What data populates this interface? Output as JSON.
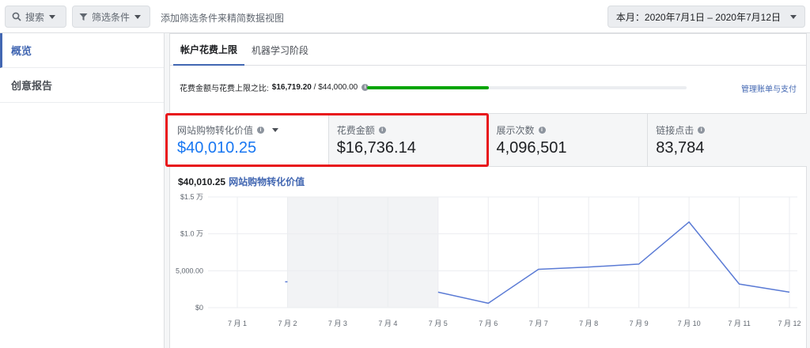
{
  "topbar": {
    "search_label": "搜索",
    "filter_label": "筛选条件",
    "hint": "添加筛选条件来精简数据视图",
    "date_range": "本月：2020年7月1日 – 2020年7月12日"
  },
  "sidebar": {
    "items": [
      {
        "label": "概览",
        "active": true
      },
      {
        "label": "创意报告",
        "active": false
      }
    ]
  },
  "tabs": [
    {
      "label": "帐户花费上限",
      "active": true
    },
    {
      "label": "机器学习阶段",
      "active": false
    }
  ],
  "spend": {
    "label": "花费金额与花费上限之比:",
    "spent": "$16,719.20",
    "separator": " / ",
    "limit": "$44,000.00",
    "progress": 0.38,
    "manage_link": "管理账单与支付"
  },
  "metrics": [
    {
      "label": "网站购物转化价值",
      "value": "$40,010.25"
    },
    {
      "label": "花费金额",
      "value": "$16,736.14"
    },
    {
      "label": "展示次数",
      "value": "4,096,501"
    },
    {
      "label": "链接点击",
      "value": "83,784"
    }
  ],
  "colors": {
    "accent": "#4267b2",
    "highlight": "#e8151b",
    "progress": "#00a400",
    "line": "#5b7bd5"
  },
  "chart_title": {
    "value": "$40,010.25",
    "series": "网站购物转化价值"
  },
  "chart_data": {
    "type": "line",
    "title": "$40,010.25 网站购物转化价值",
    "xlabel": "",
    "ylabel": "",
    "x": [
      "7 月 1",
      "7 月 2",
      "7 月 3",
      "7 月 4",
      "7 月 5",
      "7 月 6",
      "7 月 7",
      "7 月 8",
      "7 月 9",
      "7 月 10",
      "7 月 11",
      "7 月 12"
    ],
    "y_ticks": [
      "$0",
      "5,000.00",
      "$1.0 万",
      "$1.5 万"
    ],
    "ylim": [
      0,
      15000
    ],
    "grid": true,
    "shaded_range": [
      "7 月 2",
      "7 月 4"
    ],
    "series": [
      {
        "name": "网站购物转化价值",
        "values": [
          null,
          3500,
          null,
          null,
          2100,
          600,
          5200,
          5500,
          5900,
          11600,
          3200,
          2100
        ]
      }
    ]
  }
}
